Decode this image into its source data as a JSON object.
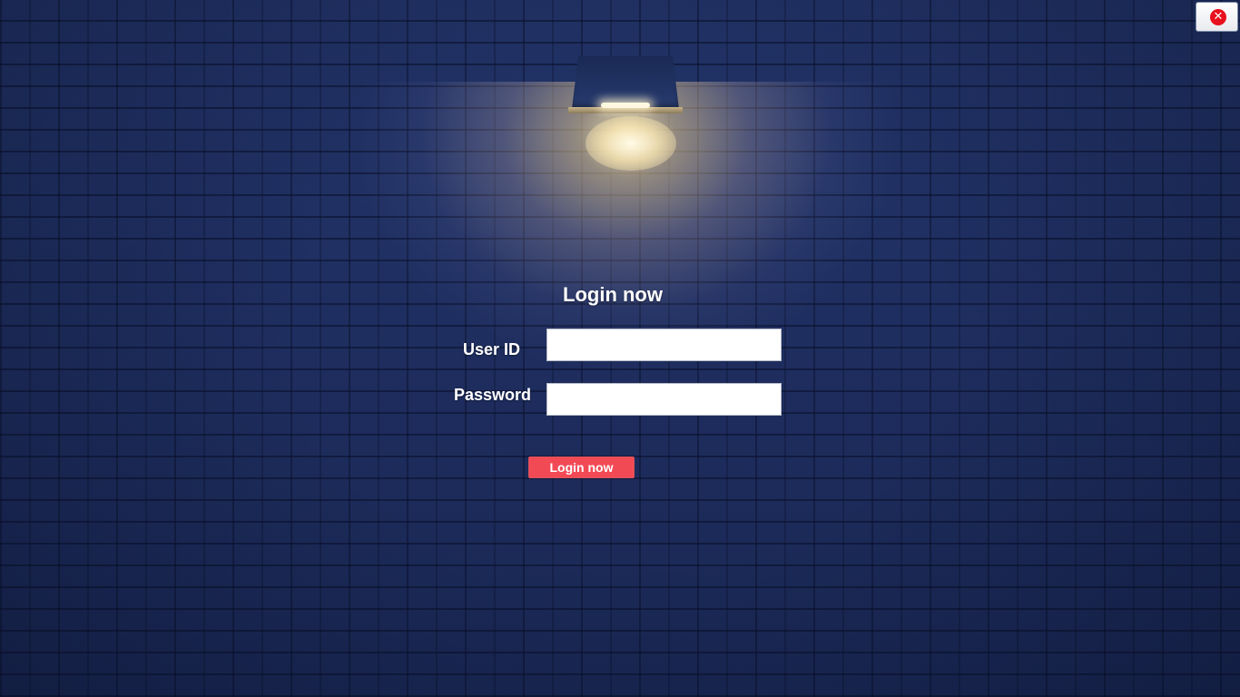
{
  "window": {
    "close_icon": "close-icon",
    "close_glyph": "✕"
  },
  "login_form": {
    "title": "Login now",
    "user_id_label": "User ID",
    "user_id_value": "",
    "password_label": "Password",
    "password_value": "",
    "submit_label": "Login now"
  },
  "colors": {
    "background": "#1f2f62",
    "submit_button": "#f24a55",
    "close_icon": "#e8101c",
    "text": "#ffffff"
  }
}
